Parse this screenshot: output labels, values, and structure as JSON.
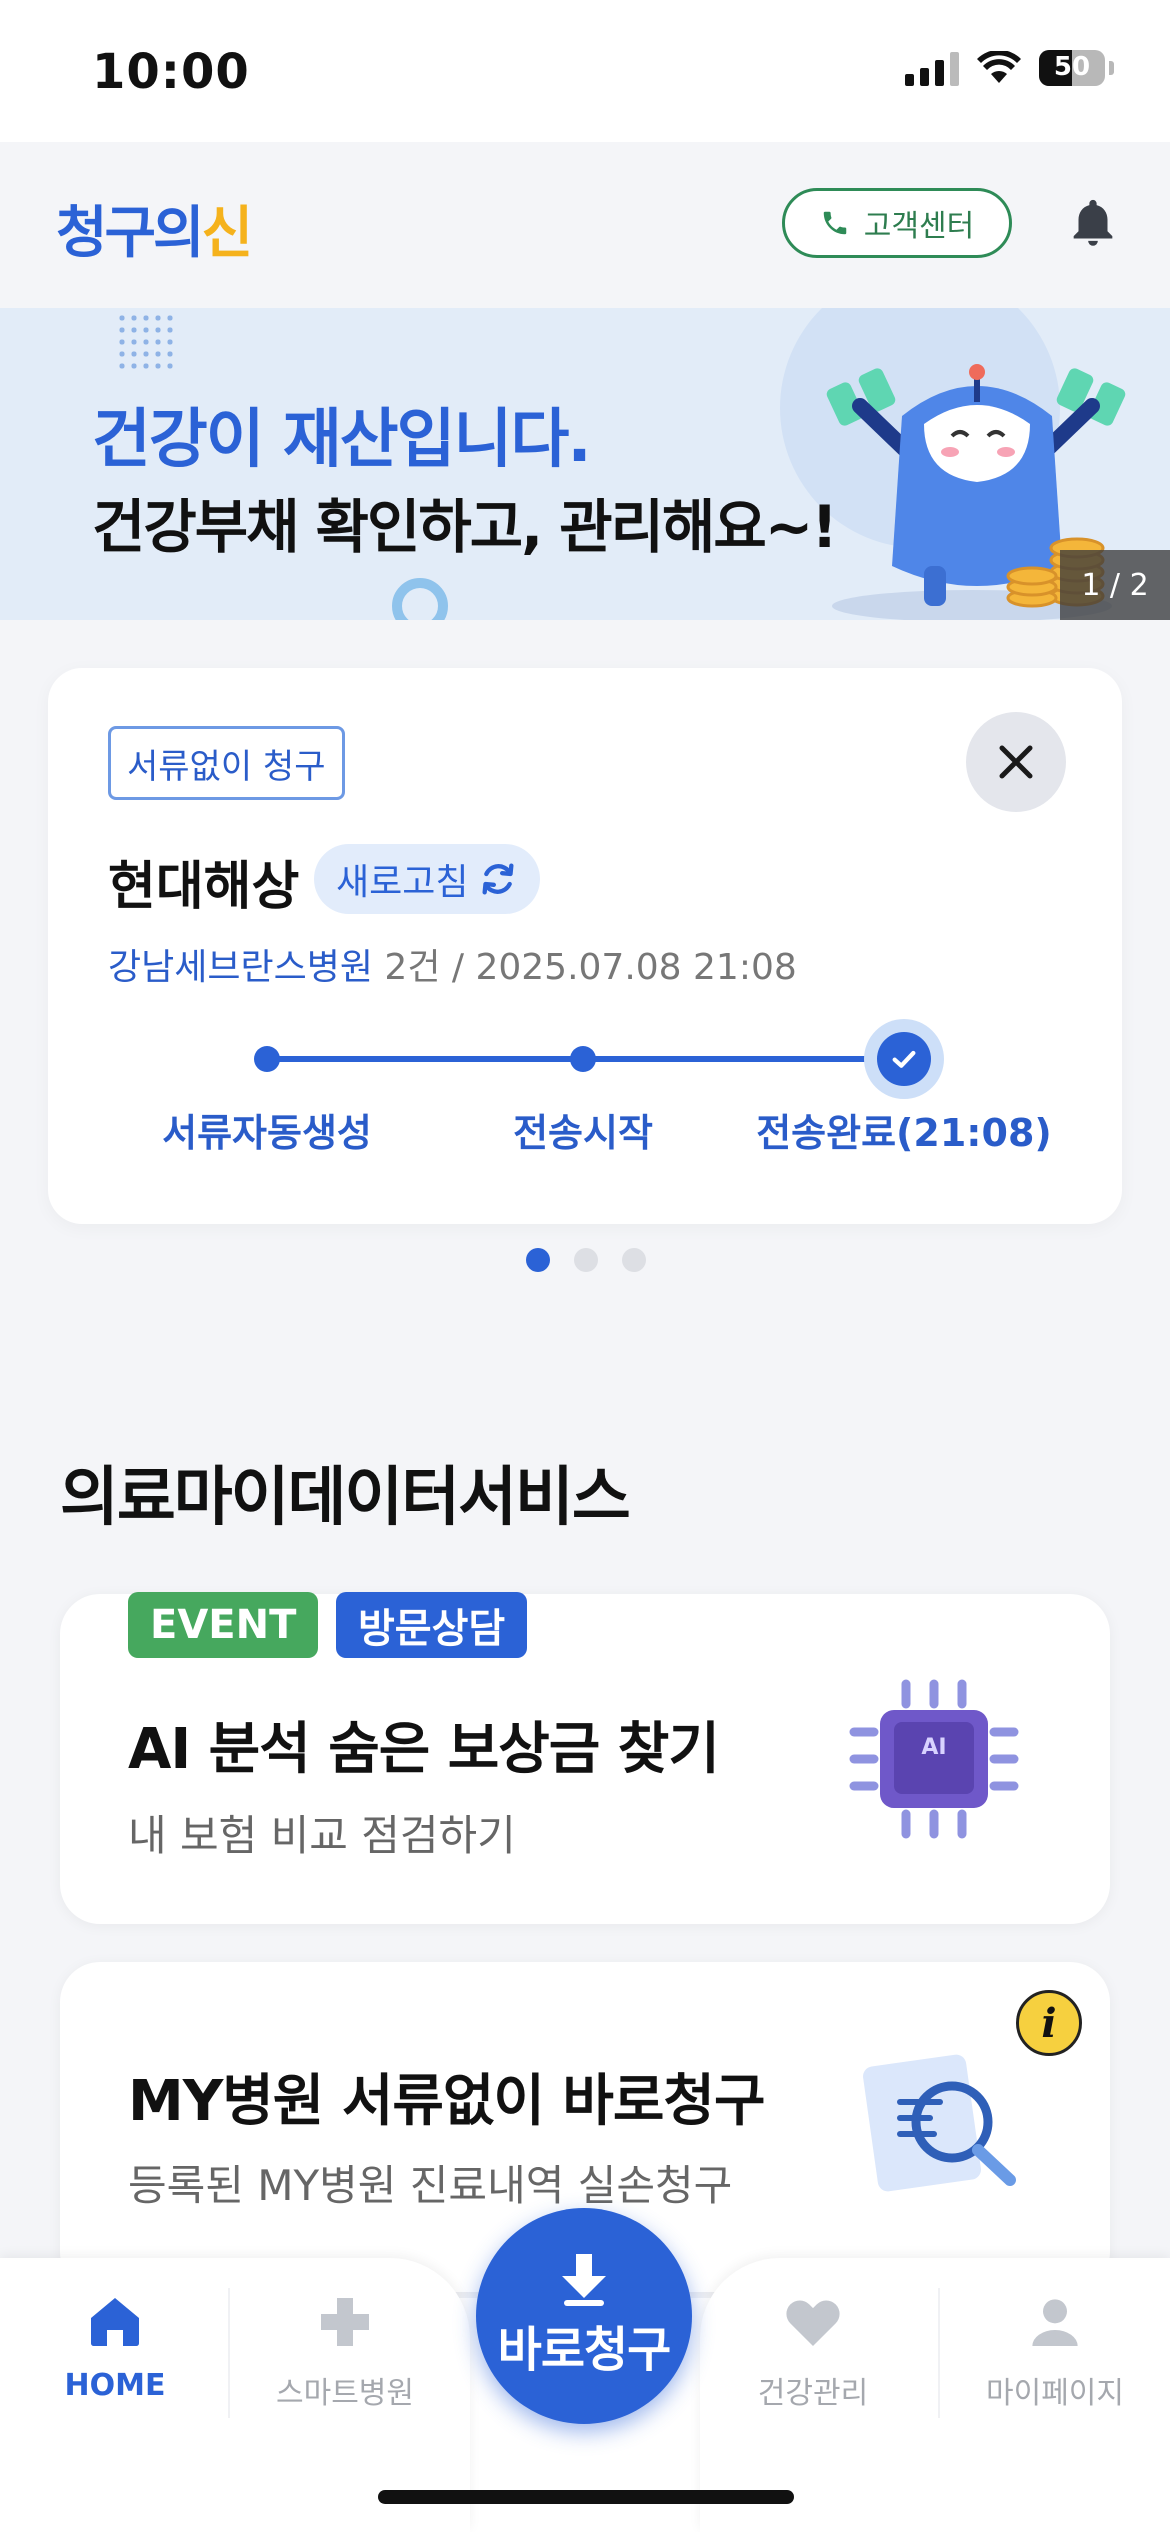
{
  "status_bar": {
    "time": "10:00",
    "battery": "50",
    "battery_level": 0.5
  },
  "header": {
    "logo_part1": "청구의",
    "logo_part2": "신",
    "customer_center": "고객센터"
  },
  "banner": {
    "title": "건강이 재산입니다.",
    "subtitle": "건강부채 확인하고, 관리해요~!",
    "counter": "1 / 2"
  },
  "claim_card": {
    "tag": "서류없이 청구",
    "company": "현대해상",
    "refresh_label": "새로고침",
    "hospital": "강남세브란스병원",
    "detail": " 2건 / 2025.07.08 21:08",
    "steps": [
      "서류자동생성",
      "전송시작",
      "전송완료(21:08)"
    ]
  },
  "section": {
    "title": "의료마이데이터서비스"
  },
  "services": [
    {
      "badges": [
        "EVENT",
        "방문상담"
      ],
      "title": "AI 분석 숨은 보상금 찾기",
      "desc": "내 보험 비교 점검하기",
      "icon_text": "AI"
    },
    {
      "title": "MY병원 서류없이 바로청구",
      "desc": "등록된 MY병원 진료내역 실손청구",
      "info": "i"
    }
  ],
  "bottom_nav": {
    "items": [
      "HOME",
      "스마트병원",
      "건강관리",
      "마이페이지"
    ],
    "fab_label": "바로청구"
  },
  "colors": {
    "primary": "#2b62d6",
    "accent_yellow": "#f5b21c",
    "event_green": "#46a85e"
  }
}
